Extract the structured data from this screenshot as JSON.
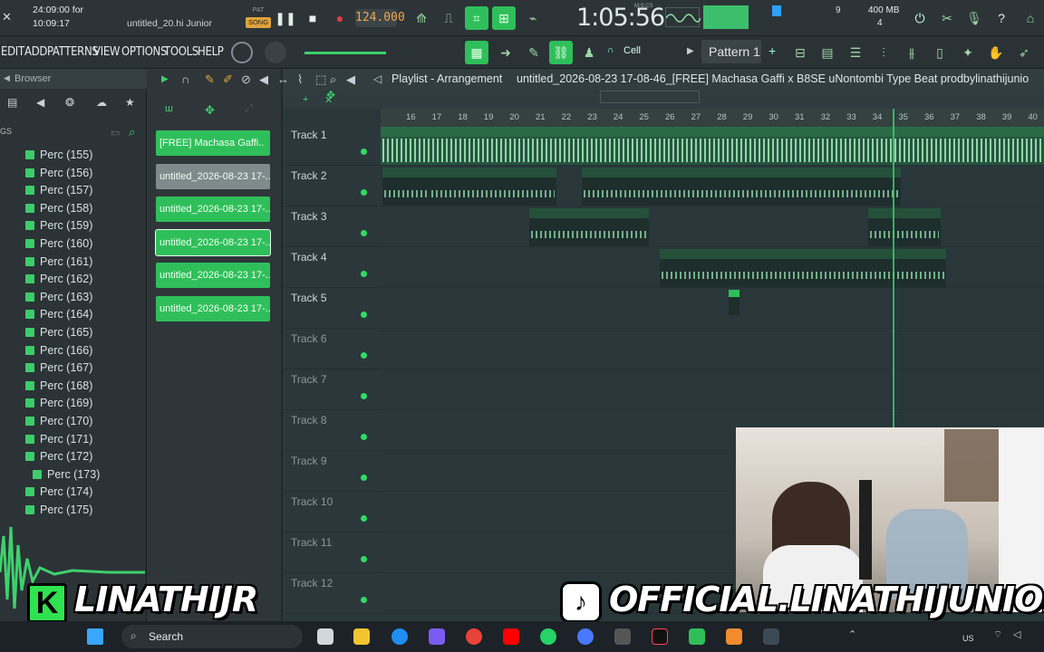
{
  "top": {
    "time_display": "24:09:00 for",
    "time_display2": "10:09:17",
    "project_name": "untitled_20.hi Junior",
    "mode_pat": "PAT",
    "mode_song": "SONG",
    "tempo": "124.000",
    "clock": "1:05:56",
    "clock_unit": "M:S:CS",
    "cpu_num": "9",
    "mem": "400 MB",
    "mem2": "4"
  },
  "menu": {
    "items": [
      "EDIT",
      "ADD",
      "PATTERNS",
      "VIEW",
      "OPTIONS",
      "TOOLS",
      "HELP"
    ],
    "snap": "Cell",
    "pattern": "Pattern 1"
  },
  "browser": {
    "title": "Browser",
    "items": [
      "Perc (155)",
      "Perc (156)",
      "Perc (157)",
      "Perc (158)",
      "Perc (159)",
      "Perc (160)",
      "Perc (161)",
      "Perc (162)",
      "Perc (163)",
      "Perc (164)",
      "Perc (165)",
      "Perc (166)",
      "Perc (167)",
      "Perc (168)",
      "Perc (169)",
      "Perc (170)",
      "Perc (171)",
      "Perc (172)",
      "Perc (173)",
      "Perc (174)",
      "Perc (175)"
    ]
  },
  "picker": {
    "items": [
      "[FREE] Machasa Gaffi..",
      "untitled_2026-08-23 17-..",
      "untitled_2026-08-23 17-..",
      "untitled_2026-08-23 17-..",
      "untitled_2026-08-23 17-..",
      "untitled_2026-08-23 17-.."
    ]
  },
  "playlist": {
    "title": "Playlist - Arrangement",
    "subtitle": "untitled_2026-08-23 17-08-46_[FREE] Machasa Gaffi x B8SE uNontombi Type Beat  prodbylinathijunio",
    "ruler": [
      "16",
      "17",
      "18",
      "19",
      "20",
      "21",
      "22",
      "23",
      "24",
      "25",
      "26",
      "27",
      "28",
      "29",
      "30",
      "31",
      "32",
      "33",
      "34",
      "35",
      "36",
      "37",
      "38",
      "39",
      "40"
    ],
    "tracks": [
      "Track 1",
      "Track 2",
      "Track 3",
      "Track 4",
      "Track 5",
      "Track 6",
      "Track 7",
      "Track 8",
      "Track 9",
      "Track 10",
      "Track 11",
      "Track 12"
    ],
    "clips": {
      "t1": "[FREE] Machasa Gaffi x B8SE uNontombi Type Beat  prodbylinathijunior – Linathi Junior",
      "t2a": "unti..t 1",
      "t2b": "untitled_2026..3–-00_Insert 1",
      "t2c": "untitled_2026-08-23 17-08-46_[FRE..bylinathijunior – Linathi Junior",
      "t3a": "untitled_202..–-00_Insert 1",
      "t3b": "untitled..junior",
      "t4": "untitled_2026-08-23 17-09-28_[FREE..odbylinathijunior – Linathi Junior"
    }
  },
  "overlays": {
    "left_brand": "LINATHIJR",
    "right_brand": "OFFICIAL.LINATHIJUNIOR"
  },
  "taskbar": {
    "search_placeholder": "Search",
    "lang": "US"
  }
}
